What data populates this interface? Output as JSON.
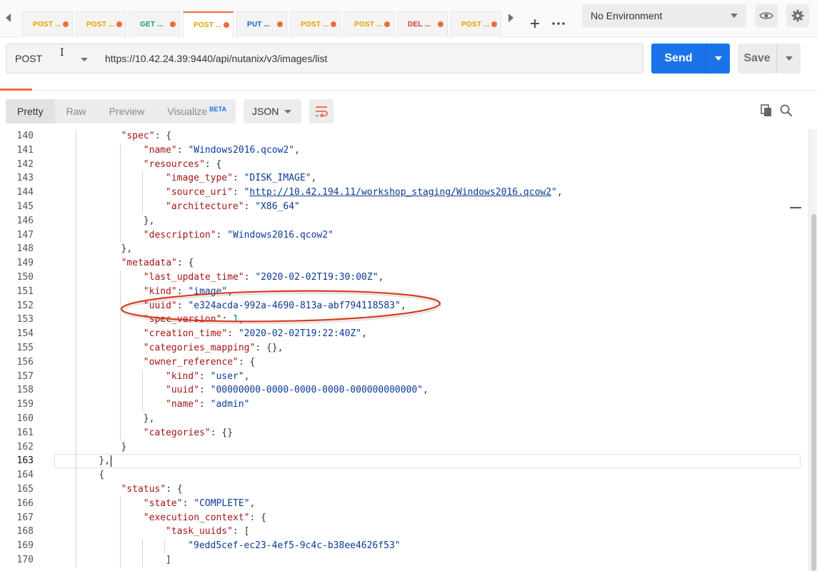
{
  "tabs": [
    {
      "method": "POST",
      "color": "#e5a000",
      "active": false
    },
    {
      "method": "POST",
      "color": "#e5a000",
      "active": false
    },
    {
      "method": "GET",
      "color": "#0aa06e",
      "active": false
    },
    {
      "method": "POST",
      "color": "#e5a000",
      "active": true
    },
    {
      "method": "PUT",
      "color": "#0b5fd1",
      "active": false
    },
    {
      "method": "POST",
      "color": "#e5a000",
      "active": false
    },
    {
      "method": "POST",
      "color": "#e5a000",
      "active": false
    },
    {
      "method": "DEL",
      "color": "#e03030",
      "active": false
    },
    {
      "method": "POST",
      "color": "#e5a000",
      "active": false
    }
  ],
  "tab_ellipsis": "...",
  "environment": {
    "selected": "No Environment"
  },
  "request": {
    "method": "POST",
    "url": "https://10.42.24.39:9440/api/nutanix/v3/images/list",
    "send_label": "Send",
    "save_label": "Save"
  },
  "response": {
    "views": [
      "Pretty",
      "Raw",
      "Preview",
      "Visualize"
    ],
    "active_view": "Pretty",
    "visualize_badge": "BETA",
    "format": "JSON"
  },
  "editor": {
    "current_line": 163,
    "lines": [
      {
        "n": 140,
        "indent": 3,
        "html": "<span class=\"k\">\"spec\"</span>: {"
      },
      {
        "n": 141,
        "indent": 4,
        "html": "<span class=\"k\">\"name\"</span>: <span class=\"s\">\"Windows2016.qcow2\"</span>,"
      },
      {
        "n": 142,
        "indent": 4,
        "html": "<span class=\"k\">\"resources\"</span>: {"
      },
      {
        "n": 143,
        "indent": 5,
        "html": "<span class=\"k\">\"image_type\"</span>: <span class=\"s\">\"DISK_IMAGE\"</span>,"
      },
      {
        "n": 144,
        "indent": 5,
        "html": "<span class=\"k\">\"source_uri\"</span>: <span class=\"s\">\"<span class=\"url-link\">http://10.42.194.11/workshop_staging/Windows2016.qcow2</span>\"</span>,"
      },
      {
        "n": 145,
        "indent": 5,
        "html": "<span class=\"k\">\"architecture\"</span>: <span class=\"s\">\"X86_64\"</span>"
      },
      {
        "n": 146,
        "indent": 4,
        "html": "},"
      },
      {
        "n": 147,
        "indent": 4,
        "html": "<span class=\"k\">\"description\"</span>: <span class=\"s\">\"Windows2016.qcow2\"</span>"
      },
      {
        "n": 148,
        "indent": 3,
        "html": "},"
      },
      {
        "n": 149,
        "indent": 3,
        "html": "<span class=\"k\">\"metadata\"</span>: {"
      },
      {
        "n": 150,
        "indent": 4,
        "html": "<span class=\"k\">\"last_update_time\"</span>: <span class=\"s\">\"2020-02-02T19:30:00Z\"</span>,"
      },
      {
        "n": 151,
        "indent": 4,
        "html": "<span class=\"k\">\"kind\"</span>: <span class=\"s\">\"image\"</span>,"
      },
      {
        "n": 152,
        "indent": 4,
        "html": "<span class=\"k\">\"uuid\"</span>: <span class=\"s\">\"e324acda-992a-4690-813a-abf794118583\"</span>,"
      },
      {
        "n": 153,
        "indent": 4,
        "html": "<span class=\"k\">\"spec_version\"</span>: <span class=\"n\">1</span>,"
      },
      {
        "n": 154,
        "indent": 4,
        "html": "<span class=\"k\">\"creation_time\"</span>: <span class=\"s\">\"2020-02-02T19:22:40Z\"</span>,"
      },
      {
        "n": 155,
        "indent": 4,
        "html": "<span class=\"k\">\"categories_mapping\"</span>: {},"
      },
      {
        "n": 156,
        "indent": 4,
        "html": "<span class=\"k\">\"owner_reference\"</span>: {"
      },
      {
        "n": 157,
        "indent": 5,
        "html": "<span class=\"k\">\"kind\"</span>: <span class=\"s\">\"user\"</span>,"
      },
      {
        "n": 158,
        "indent": 5,
        "html": "<span class=\"k\">\"uuid\"</span>: <span class=\"s\">\"00000000-0000-0000-0000-000000000000\"</span>,"
      },
      {
        "n": 159,
        "indent": 5,
        "html": "<span class=\"k\">\"name\"</span>: <span class=\"s\">\"admin\"</span>"
      },
      {
        "n": 160,
        "indent": 4,
        "html": "},"
      },
      {
        "n": 161,
        "indent": 4,
        "html": "<span class=\"k\">\"categories\"</span>: {}"
      },
      {
        "n": 162,
        "indent": 3,
        "html": "}"
      },
      {
        "n": 163,
        "indent": 2,
        "html": "},"
      },
      {
        "n": 164,
        "indent": 2,
        "html": "{"
      },
      {
        "n": 165,
        "indent": 3,
        "html": "<span class=\"k\">\"status\"</span>: {"
      },
      {
        "n": 166,
        "indent": 4,
        "html": "<span class=\"k\">\"state\"</span>: <span class=\"s\">\"COMPLETE\"</span>,"
      },
      {
        "n": 167,
        "indent": 4,
        "html": "<span class=\"k\">\"execution_context\"</span>: {"
      },
      {
        "n": 168,
        "indent": 5,
        "html": "<span class=\"k\">\"task_uuids\"</span>: ["
      },
      {
        "n": 169,
        "indent": 6,
        "html": "<span class=\"s\">\"9edd5cef-ec23-4ef5-9c4c-b38ee4626f53\"</span>"
      },
      {
        "n": 170,
        "indent": 5,
        "html": "]"
      }
    ]
  },
  "colors": {
    "accent": "#f26b3a",
    "send": "#1a73e8",
    "annotation": "#d93a1e"
  }
}
